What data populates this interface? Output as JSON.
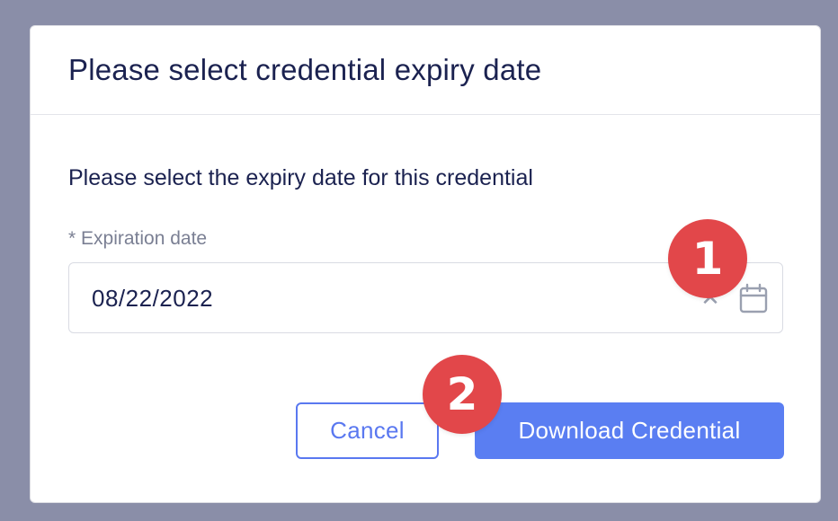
{
  "modal": {
    "title": "Please select credential expiry date",
    "instruction": "Please select the expiry date for this credential",
    "field": {
      "label": "* Expiration date",
      "value": "08/22/2022",
      "clear_icon": "close-icon",
      "calendar_icon": "calendar-icon"
    },
    "buttons": {
      "cancel_label": "Cancel",
      "download_label": "Download Credential"
    }
  },
  "annotations": {
    "badge_1": "1",
    "badge_2": "2"
  },
  "colors": {
    "overlay": "#8a8ea8",
    "primary": "#5a7ef2",
    "badge": "#e2474a",
    "text": "#1b2250"
  }
}
